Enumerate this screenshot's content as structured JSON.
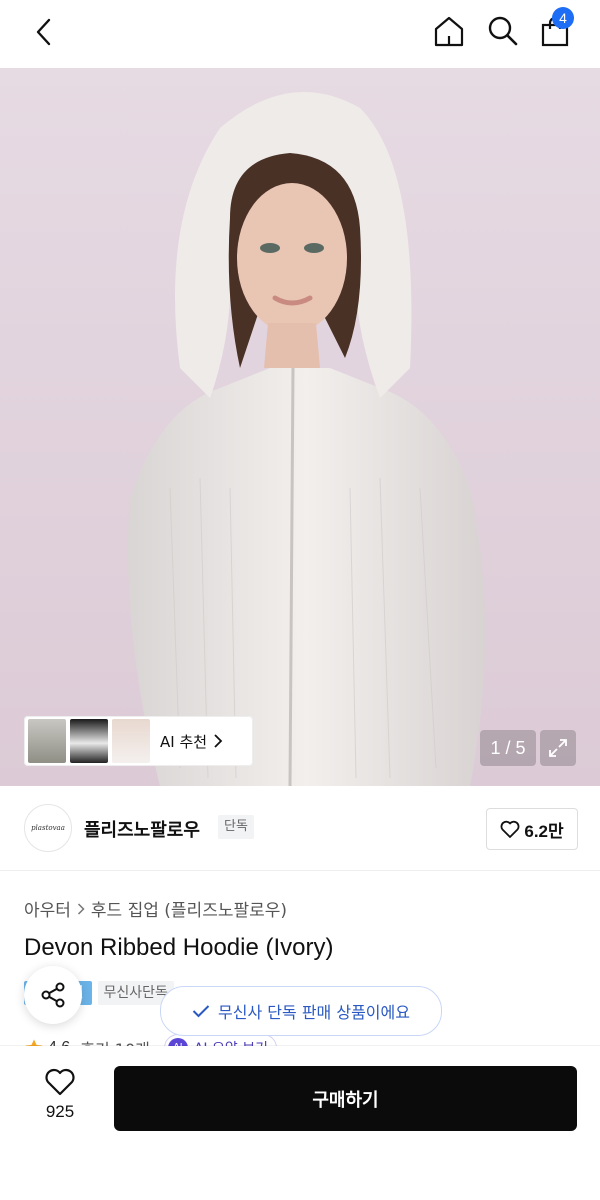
{
  "header": {
    "cart_count": "4"
  },
  "gallery": {
    "counter": "1 / 5",
    "ai_recommend_label": "AI 추천"
  },
  "brand": {
    "logo_text": "plastovaa",
    "name": "플리즈노팔로우",
    "exclusive_tag": "단독",
    "likes": "6.2만"
  },
  "product": {
    "breadcrumb": [
      "아우터",
      "후드 집업 (플리즈노팔로우)"
    ],
    "title": "Devon Ribbed Hoodie (Ivory)",
    "tags": [
      "페스티벌",
      "무신사단독"
    ],
    "rating": "4.6",
    "reviews": "후기 10개",
    "ai_summary": "AI 요약 보기",
    "ai_badge": "AI"
  },
  "toast": {
    "message": "무신사 단독 판매 상품이에요"
  },
  "bottom": {
    "wish_count": "925",
    "buy_label": "구매하기"
  },
  "colors": {
    "accent_blue": "#1d6ef5",
    "buy_button": "#0b0b0b",
    "festival_tag": "#6bb3e8",
    "hero_bg": "#e4d6df"
  }
}
